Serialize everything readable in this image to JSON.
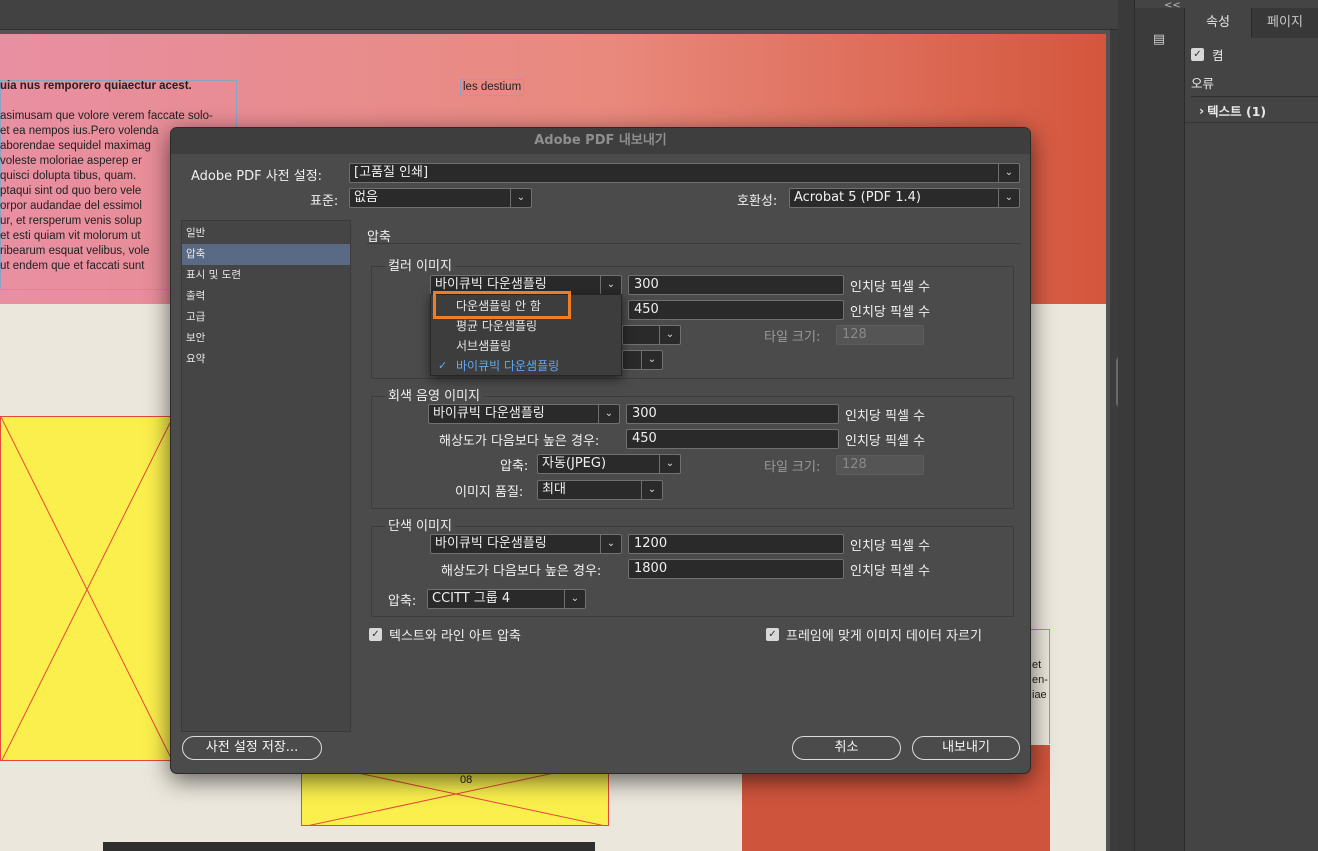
{
  "canvas": {
    "heading": "uia nus remporero quiaectur acest.",
    "paragraph": [
      "asimusam que volore verem faccate solo-",
      " et ea nempos ius.Pero volenda",
      "aborendae sequidel maximag",
      "voleste moloriae asperep er",
      " quisci dolupta tibus, quam.",
      "ptaqui sint od quo bero vele",
      "orpor audandae del essimol",
      "ur, et rersperum venis solup",
      " et esti quiam vit molorum ut",
      "ribearum esquat velibus, vole",
      "ut endem que et faccati sunt"
    ],
    "tag_text": "les destium",
    "page_number": "08",
    "right_fragment": [
      "et",
      "en-",
      "iae"
    ]
  },
  "right_panel": {
    "collapse_glyph": "<<",
    "tool_icon": "pages-icon",
    "tabs": [
      {
        "label": "속성",
        "active": true
      },
      {
        "label": "페이지",
        "active": false
      }
    ],
    "checkbox_label": "켬",
    "checkbox_checked": true,
    "errors_label": "오류",
    "error_item": "텍스트 (1)"
  },
  "dialog": {
    "title": "Adobe PDF 내보내기",
    "preset_label": "Adobe PDF 사전 설정:",
    "preset_value": "[고품질 인쇄]",
    "standard_label": "표준:",
    "standard_value": "없음",
    "compat_label": "호환성:",
    "compat_value": "Acrobat 5 (PDF 1.4)",
    "categories": [
      {
        "label": "일반",
        "active": false
      },
      {
        "label": "압축",
        "active": true
      },
      {
        "label": "표시 및 도련",
        "active": false
      },
      {
        "label": "출력",
        "active": false
      },
      {
        "label": "고급",
        "active": false
      },
      {
        "label": "보안",
        "active": false
      },
      {
        "label": "요약",
        "active": false
      }
    ],
    "section_title": "압축",
    "color": {
      "title": "컬러 이미지",
      "sampling_value": "바이큐빅 다운샘플링",
      "ppi_value": "300",
      "ppi_unit": "인치당 픽셀 수",
      "above_value": "450",
      "above_unit": "인치당 픽셀 수",
      "tile_label": "타일 크기:",
      "tile_value": "128"
    },
    "popup": {
      "items": [
        {
          "label": "다운샘플링 안 함",
          "selected": false
        },
        {
          "label": "평균 다운샘플링",
          "selected": false
        },
        {
          "label": "서브샘플링",
          "selected": false
        },
        {
          "label": "바이큐빅 다운샘플링",
          "selected": true
        }
      ],
      "check_glyph": "✓"
    },
    "gray": {
      "title": "회색 음영 이미지",
      "sampling_value": "바이큐빅 다운샘플링",
      "ppi_value": "300",
      "ppi_unit": "인치당 픽셀 수",
      "above_label": "해상도가 다음보다 높은 경우:",
      "above_value": "450",
      "above_unit": "인치당 픽셀 수",
      "compression_label": "압축:",
      "compression_value": "자동(JPEG)",
      "tile_label": "타일 크기:",
      "tile_value": "128",
      "quality_label": "이미지 품질:",
      "quality_value": "최대"
    },
    "mono": {
      "title": "단색 이미지",
      "sampling_value": "바이큐빅 다운샘플링",
      "ppi_value": "1200",
      "ppi_unit": "인치당 픽셀 수",
      "above_label": "해상도가 다음보다 높은 경우:",
      "above_value": "1800",
      "above_unit": "인치당 픽셀 수",
      "compression_label": "압축:",
      "compression_value": "CCITT 그룹 4"
    },
    "compress_text_label": "텍스트와 라인 아트 압축",
    "compress_text_checked": true,
    "crop_label": "프레임에 맞게 이미지 데이터 자르기",
    "crop_checked": true,
    "save_preset_button": "사전 설정 저장...",
    "cancel_button": "취소",
    "export_button": "내보내기",
    "dropdown_arrow": "⌄",
    "checkmark": "✓"
  }
}
